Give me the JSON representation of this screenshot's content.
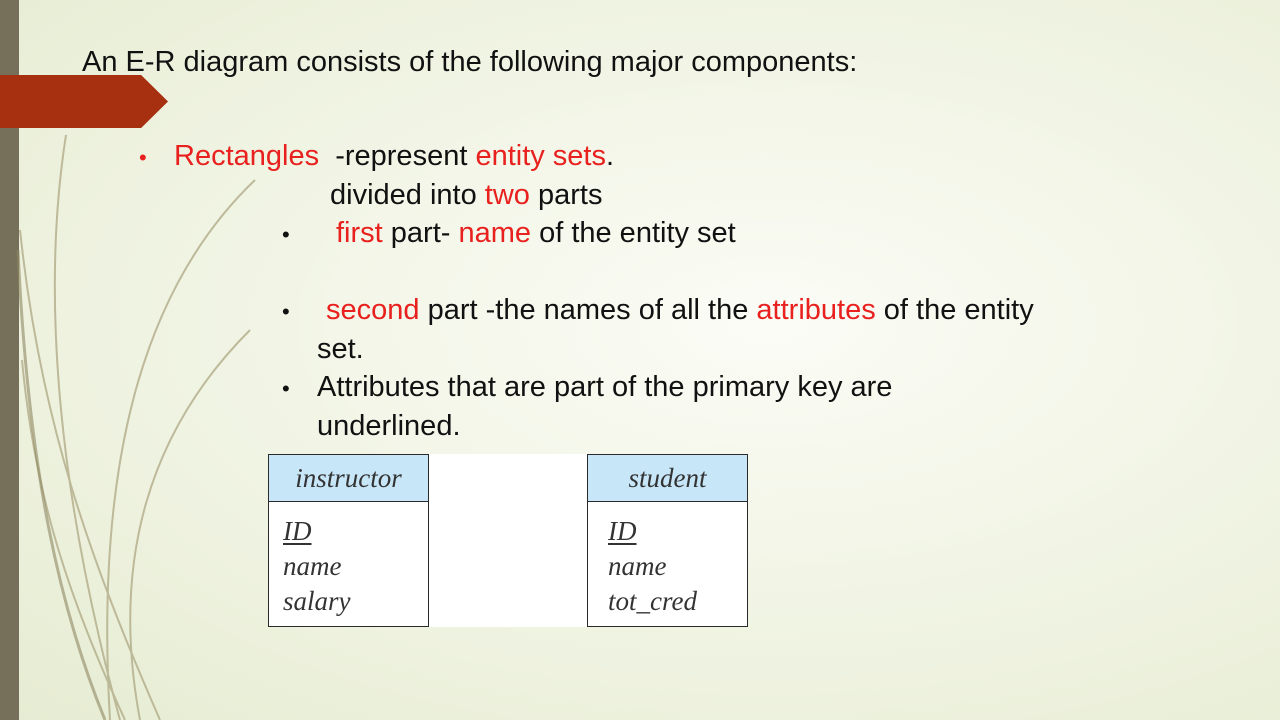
{
  "slide": {
    "heading": "An E-R diagram consists of the following major components:",
    "bullet_main": {
      "term": "Rectangles",
      "text_1": "  -represent ",
      "term_2": "entity sets",
      "text_2": "."
    },
    "divided_line": {
      "text_1": "divided into ",
      "term": "two",
      "text_2": " parts"
    },
    "sub_first": {
      "term": "first",
      "text_1": " part- ",
      "term_2": "name",
      "text_2": " of the entity set"
    },
    "sub_second": {
      "term": "second",
      "text_1": " part -the names of all the ",
      "term_2": "attributes",
      "text_2": " of the entity",
      "text_3": "set."
    },
    "sub_pk": {
      "line_1": "Attributes that are part of the primary key are",
      "line_2": "underlined."
    },
    "bullet_symbol": "•"
  },
  "entities": [
    {
      "name": "instructor",
      "primary_key": "ID",
      "attributes": [
        "name",
        "salary"
      ]
    },
    {
      "name": "student",
      "primary_key": "ID",
      "attributes": [
        "name",
        "tot_cred"
      ]
    }
  ],
  "colors": {
    "highlight": "#e8201e",
    "accent_tab": "#a6300f",
    "left_bar": "#76705a",
    "entity_header": "#c7e6f8"
  }
}
